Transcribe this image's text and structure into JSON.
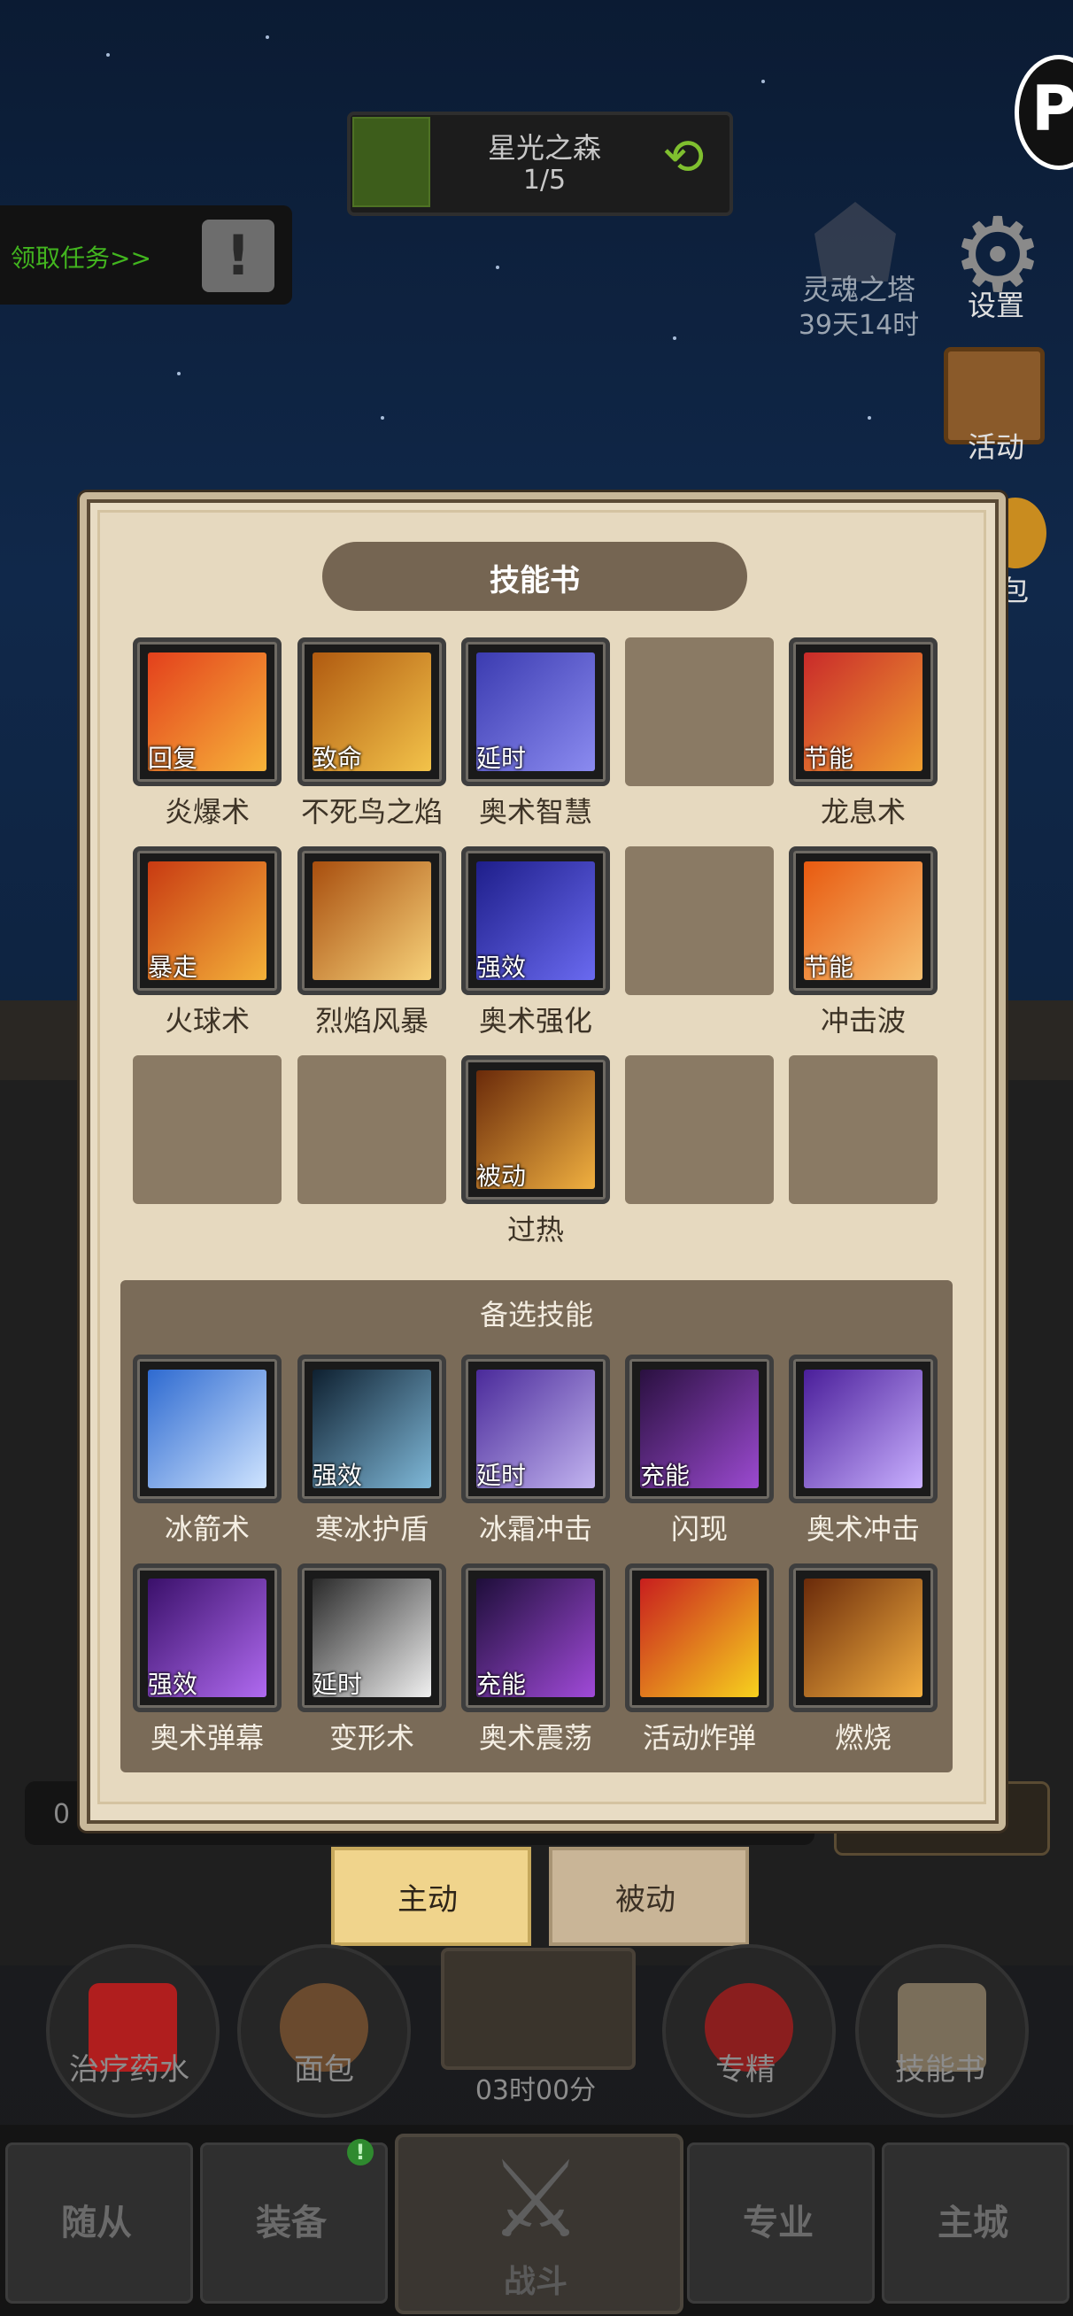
{
  "stage": {
    "name": "星光之森",
    "progress": "1/5"
  },
  "quest": {
    "label": "领取任务>>"
  },
  "side_menu": {
    "tower_name": "灵魂之塔",
    "tower_time": "39天14时",
    "settings": "设置",
    "activity": "活动",
    "pack": "包"
  },
  "behind": {
    "input_text": "0"
  },
  "panel": {
    "title": "技能书",
    "skills": [
      {
        "name": "炎爆术",
        "tag": "回复"
      },
      {
        "name": "不死鸟之焰",
        "tag": "致命"
      },
      {
        "name": "奥术智慧",
        "tag": "延时"
      },
      {
        "name": "",
        "tag": ""
      },
      {
        "name": "龙息术",
        "tag": "节能"
      },
      {
        "name": "火球术",
        "tag": "暴走"
      },
      {
        "name": "烈焰风暴",
        "tag": ""
      },
      {
        "name": "奥术强化",
        "tag": "强效"
      },
      {
        "name": "",
        "tag": ""
      },
      {
        "name": "冲击波",
        "tag": "节能"
      },
      {
        "name": "",
        "tag": ""
      },
      {
        "name": "",
        "tag": ""
      },
      {
        "name": "过热",
        "tag": "被动"
      },
      {
        "name": "",
        "tag": ""
      },
      {
        "name": "",
        "tag": ""
      }
    ],
    "alt_title": "备选技能",
    "alt_skills": [
      {
        "name": "冰箭术",
        "tag": ""
      },
      {
        "name": "寒冰护盾",
        "tag": "强效"
      },
      {
        "name": "冰霜冲击",
        "tag": "延时"
      },
      {
        "name": "闪现",
        "tag": "充能"
      },
      {
        "name": "奥术冲击",
        "tag": ""
      },
      {
        "name": "奥术弹幕",
        "tag": "强效"
      },
      {
        "name": "变形术",
        "tag": "延时"
      },
      {
        "name": "奥术震荡",
        "tag": "充能"
      },
      {
        "name": "活动炸弹",
        "tag": ""
      },
      {
        "name": "燃烧",
        "tag": ""
      }
    ]
  },
  "tabs": {
    "active": "主动",
    "passive": "被动"
  },
  "actions": {
    "potion": "治疗药水",
    "bread": "面包",
    "timer": "03时00分",
    "mastery": "专精",
    "skillbook": "技能书"
  },
  "nav": {
    "followers": "随从",
    "equipment": "装备",
    "battle": "战斗",
    "profession": "专业",
    "main_city": "主城",
    "equip_badge": "!"
  },
  "colors": {
    "panel_bg": "#e8dcc4",
    "banner": "#756552",
    "alt_bg": "#7a6b58",
    "tab_active": "#f0d48c",
    "quest_green": "#42b51f"
  },
  "icons": {
    "refresh": "refresh-icon",
    "quest": "exclamation-icon",
    "settings": "gear-icon",
    "battle": "crossed-swords-icon"
  }
}
